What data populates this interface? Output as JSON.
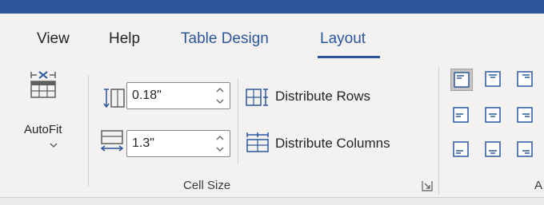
{
  "tabs": [
    {
      "label": "View"
    },
    {
      "label": "Help"
    },
    {
      "label": "Table Design"
    },
    {
      "label": "Layout"
    }
  ],
  "autofit": {
    "label": "AutoFit"
  },
  "cell_size": {
    "height_value": "0.18\"",
    "width_value": "1.3\"",
    "distribute_rows_label": "Distribute Rows",
    "distribute_columns_label": "Distribute Columns",
    "group_label": "Cell Size"
  },
  "alignment": {
    "group_label_partial": "A",
    "buttons": [
      "top-left",
      "top-center",
      "top-right",
      "middle-left",
      "middle-center",
      "middle-right",
      "bottom-left",
      "bottom-center",
      "bottom-right"
    ],
    "selected": "top-left"
  },
  "colors": {
    "accent": "#2b579a",
    "ribbon_bg": "#f3f2f1"
  }
}
